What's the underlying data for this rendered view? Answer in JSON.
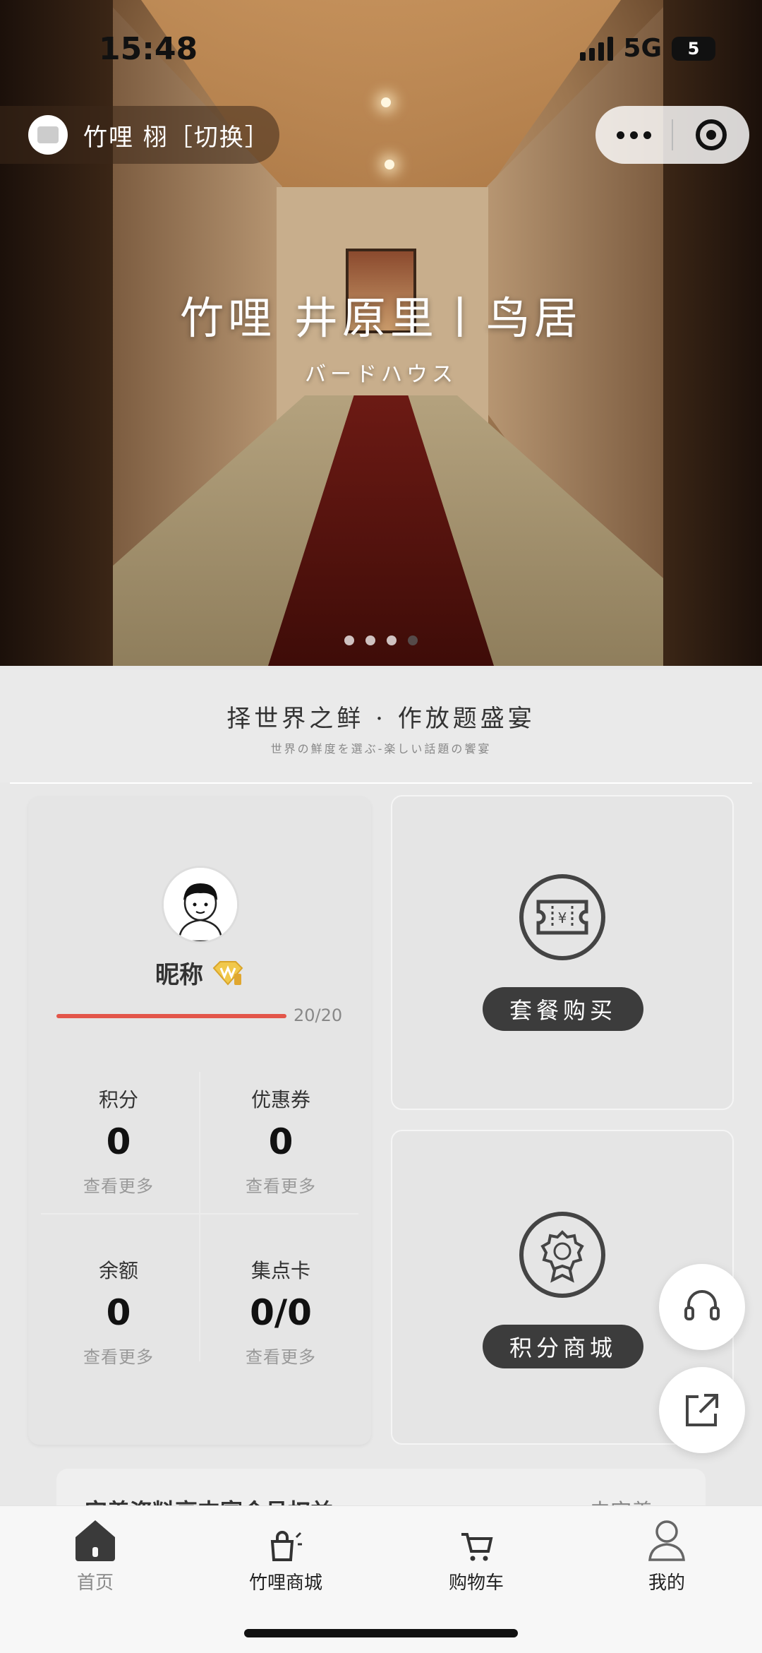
{
  "status_bar": {
    "time": "15:48",
    "network": "5G",
    "battery": "5"
  },
  "header": {
    "store_name": "竹哩 栩［切换］"
  },
  "banner": {
    "title": "竹哩 井原里丨鸟居",
    "subtitle": "バードハウス",
    "slide_count": 4,
    "active_slide": 4
  },
  "slogan": {
    "main": "择世界之鲜 · 作放题盛宴",
    "sub": "世界の鮮度を選ぶ-楽しい話題の饗宴"
  },
  "member": {
    "nickname": "昵称",
    "progress_text": "20/20",
    "progress_fraction": 1.0,
    "stats": [
      {
        "label": "积分",
        "value": "0",
        "more": "查看更多"
      },
      {
        "label": "优惠券",
        "value": "0",
        "more": "查看更多"
      },
      {
        "label": "余额",
        "value": "0",
        "more": "查看更多"
      },
      {
        "label": "集点卡",
        "value": "0/0",
        "more": "查看更多"
      }
    ]
  },
  "actions": {
    "package": {
      "label": "套餐购买",
      "icon": "ticket-yen-icon"
    },
    "points_mall": {
      "label": "积分商城",
      "icon": "award-badge-icon"
    }
  },
  "floating": {
    "support_icon": "headset-icon",
    "share_icon": "share-icon"
  },
  "info_strip": {
    "title": "完善资料享丰富会员权益",
    "action": "去完善 >"
  },
  "tabs": [
    {
      "label": "首页",
      "icon": "home-icon"
    },
    {
      "label": "竹哩商城",
      "icon": "shopping-bag-icon"
    },
    {
      "label": "购物车",
      "icon": "cart-icon"
    },
    {
      "label": "我的",
      "icon": "user-icon"
    }
  ],
  "colors": {
    "accent": "#3c3c3c",
    "progress": "#e3564a",
    "background": "#e8e8e8"
  }
}
